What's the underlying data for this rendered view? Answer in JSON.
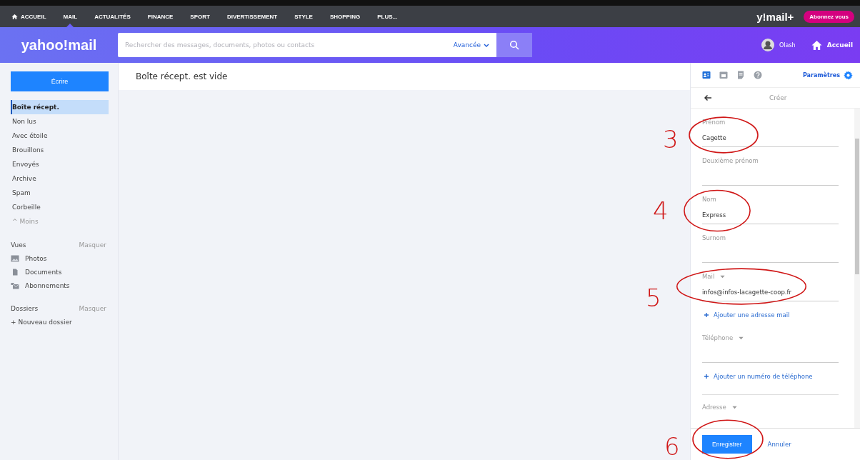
{
  "topnav": {
    "items": [
      {
        "label": "ACCUEIL",
        "selected": false,
        "home": true
      },
      {
        "label": "MAIL",
        "selected": true,
        "home": false
      },
      {
        "label": "ACTUALITÉS",
        "selected": false,
        "home": false
      },
      {
        "label": "FINANCE",
        "selected": false,
        "home": false
      },
      {
        "label": "SPORT",
        "selected": false,
        "home": false
      },
      {
        "label": "DIVERTISSEMENT",
        "selected": false,
        "home": false
      },
      {
        "label": "STYLE",
        "selected": false,
        "home": false
      },
      {
        "label": "SHOPPING",
        "selected": false,
        "home": false
      },
      {
        "label": "PLUS...",
        "selected": false,
        "home": false
      }
    ],
    "brand": "y!mail+",
    "subscribe": "Abonnez vous"
  },
  "header": {
    "logo": "yahoo!mail",
    "search": {
      "placeholder": "Rechercher des messages, documents, photos ou contacts"
    },
    "advanced": "Avancée",
    "user": "Olash",
    "home": "Accueil"
  },
  "sidebar": {
    "compose": "Écrire",
    "folders": [
      {
        "label": "Boîte récept.",
        "selected": true
      },
      {
        "label": "Non lus",
        "selected": false
      },
      {
        "label": "Avec étoile",
        "selected": false
      },
      {
        "label": "Brouillons",
        "selected": false
      },
      {
        "label": "Envoyés",
        "selected": false
      },
      {
        "label": "Archive",
        "selected": false
      },
      {
        "label": "Spam",
        "selected": false
      },
      {
        "label": "Corbeille",
        "selected": false
      }
    ],
    "less": "^ Moins",
    "views": {
      "title": "Vues",
      "toggle": "Masquer",
      "items": [
        "Photos",
        "Documents",
        "Abonnements"
      ]
    },
    "dossiers": {
      "title": "Dossiers",
      "toggle": "Masquer",
      "new": "+ Nouveau dossier"
    }
  },
  "main": {
    "title": "Boîte récept. est vide"
  },
  "panel": {
    "tabs": [
      {
        "selected": true
      },
      {
        "selected": false
      },
      {
        "selected": false
      },
      {
        "selected": false
      }
    ],
    "settings": "Paramètres",
    "heading": "Créer",
    "rows": [
      {
        "kind": "field",
        "label": "Prénom",
        "value": "Cagette",
        "dropdown": false
      },
      {
        "kind": "field",
        "label": "Deuxième prénom",
        "dropdown": false
      },
      {
        "kind": "field",
        "label": "Nom",
        "value": "Express",
        "dropdown": false
      },
      {
        "kind": "field",
        "label": "Surnom",
        "dropdown": false
      },
      {
        "kind": "field",
        "label": "Mail",
        "value": "infos@infos-lacagette-coop.fr",
        "dropdown": true
      },
      {
        "kind": "add",
        "label": "Ajouter une adresse mail"
      },
      {
        "kind": "field",
        "label": "Téléphone",
        "dropdown": true
      },
      {
        "kind": "add",
        "label": "Ajouter un numéro de téléphone"
      },
      {
        "kind": "cut",
        "label": "Adresse",
        "dropdown": true
      }
    ],
    "save": "Enregistrer",
    "cancel": "Annuler"
  },
  "annotations": [
    {
      "text": "3"
    },
    {
      "text": "4"
    },
    {
      "text": "5"
    },
    {
      "text": "6"
    }
  ]
}
